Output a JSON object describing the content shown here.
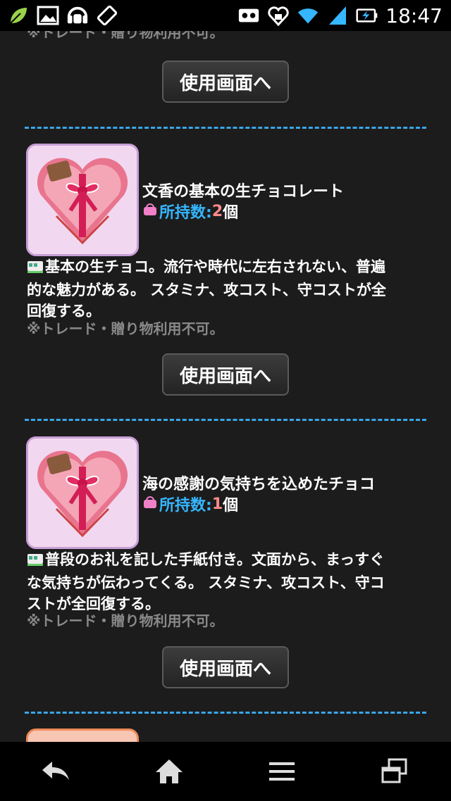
{
  "status_bar": {
    "time": "18:47",
    "left_icons": [
      "leaf-icon",
      "image-icon",
      "android-headphones-icon",
      "screen-rotation-icon"
    ],
    "right_icons": [
      "voicemail-icon",
      "heart-icon",
      "wifi-icon",
      "signal-icon",
      "battery-charging-icon"
    ]
  },
  "top_note": "※トレード・贈り物利用不可。",
  "use_button_label": "使用画面へ",
  "items": [
    {
      "name": "文香の基本の生チョコレート",
      "own_label": "所持数:",
      "own_count": "2",
      "own_unit": "個",
      "desc_lines": [
        "基本の生チョコ。流行や時代に左右されない、普遍",
        "的な魅力がある。 スタミナ、攻コスト、守コストが全",
        "回復する。"
      ],
      "note": "※トレード・贈り物利用不可。"
    },
    {
      "name": "海の感謝の気持ちを込めたチョコ",
      "own_label": "所持数:",
      "own_count": "1",
      "own_unit": "個",
      "desc_lines": [
        "普段のお礼を記した手紙付き。文面から、まっすぐ",
        "な気持ちが伝わってくる。 スタミナ、攻コスト、守コ",
        "ストが全回復する。"
      ],
      "note": "※トレード・贈り物利用不可。"
    }
  ],
  "nav_bar": {
    "buttons": [
      "back-icon",
      "home-icon",
      "menu-icon",
      "recent-apps-icon"
    ]
  },
  "colors": {
    "accent_blue": "#35b6ff",
    "count_red": "#ff8a8a",
    "divider": "#3aa6e8",
    "note_gray": "#8a8a8a"
  }
}
